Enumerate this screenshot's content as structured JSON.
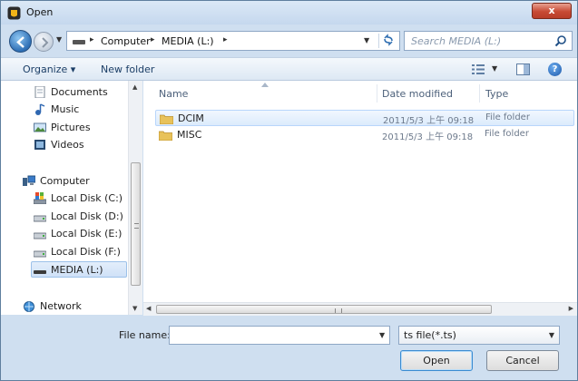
{
  "window": {
    "title": "Open",
    "close_glyph": "x"
  },
  "address": {
    "breadcrumbs": [
      "Computer",
      "MEDIA (L:)"
    ],
    "separator": "▸",
    "search_placeholder": "Search MEDIA (L:)"
  },
  "toolbar": {
    "organize": "Organize ▾",
    "new_folder": "New folder",
    "help_glyph": "?"
  },
  "nav": {
    "items": [
      {
        "label": "Documents",
        "icon": "documents-icon"
      },
      {
        "label": "Music",
        "icon": "music-icon"
      },
      {
        "label": "Pictures",
        "icon": "pictures-icon"
      },
      {
        "label": "Videos",
        "icon": "videos-icon"
      },
      {
        "label": "Computer",
        "icon": "computer-icon"
      },
      {
        "label": "Local Disk (C:)",
        "icon": "system-drive-icon"
      },
      {
        "label": "Local Disk (D:)",
        "icon": "drive-icon"
      },
      {
        "label": "Local Disk (E:)",
        "icon": "drive-icon"
      },
      {
        "label": "Local Disk (F:)",
        "icon": "drive-icon"
      },
      {
        "label": "MEDIA (L:)",
        "icon": "removable-drive-icon",
        "selected": true
      },
      {
        "label": "Network",
        "icon": "network-icon"
      }
    ]
  },
  "filelist": {
    "columns": {
      "name": "Name",
      "date": "Date modified",
      "type": "Type"
    },
    "rows": [
      {
        "name": "DCIM",
        "date": "2011/5/3 上午 09:18",
        "type": "File folder",
        "selected": true
      },
      {
        "name": "MISC",
        "date": "2011/5/3 上午 09:18",
        "type": "File folder",
        "selected": false
      }
    ]
  },
  "bottom": {
    "file_name_label": "File name:",
    "file_name_value": "",
    "file_type_value": "ts file(*.ts)",
    "open_label": "Open",
    "cancel_label": "Cancel"
  },
  "colors": {
    "accent": "#3a8bd1",
    "folder": "#e8c25a",
    "selection": "#dcebfc"
  }
}
